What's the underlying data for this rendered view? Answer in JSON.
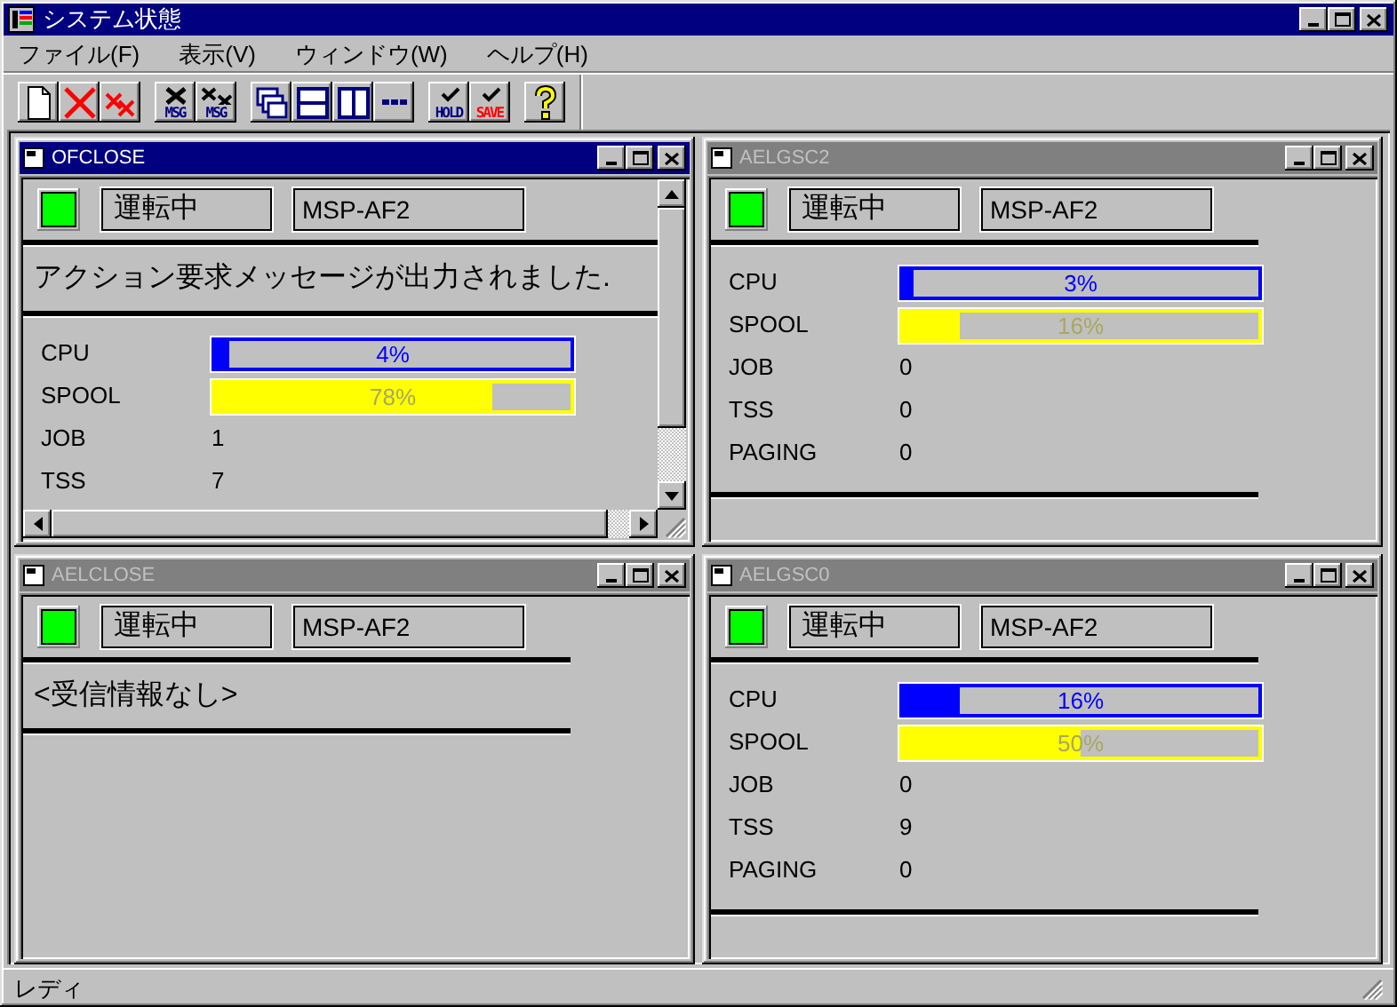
{
  "window": {
    "title": "システム状態"
  },
  "menu": [
    {
      "label": "ファイル(F)"
    },
    {
      "label": "表示(V)"
    },
    {
      "label": "ウィンドウ(W)"
    },
    {
      "label": "ヘルプ(H)"
    }
  ],
  "toolbar": [
    [
      {
        "kind": "new"
      },
      {
        "kind": "close"
      },
      {
        "kind": "close-small"
      }
    ],
    [
      {
        "kind": "x-msg",
        "label": "MSG"
      },
      {
        "kind": "xx-msg",
        "label": "MSG"
      }
    ],
    [
      {
        "kind": "cascade"
      },
      {
        "kind": "tile-h"
      },
      {
        "kind": "tile-v"
      },
      {
        "kind": "dots"
      }
    ],
    [
      {
        "kind": "hold",
        "label": "HOLD"
      },
      {
        "kind": "save",
        "label": "SAVE"
      }
    ],
    [
      {
        "kind": "help"
      }
    ]
  ],
  "children": [
    {
      "title": "OFCLOSE",
      "active": true,
      "scrollbars": true,
      "status": {
        "text": "運転中",
        "color": "#00ff00"
      },
      "system": "MSP-AF2",
      "message": "アクション要求メッセージが出力されました.",
      "metrics": [
        {
          "kind": "bar",
          "label": "CPU",
          "level": 0.04,
          "reading": "4%",
          "color": "#0000ff"
        },
        {
          "kind": "bar",
          "label": "SPOOL",
          "level": 0.78,
          "reading": "78%",
          "color": "#ffff00"
        },
        {
          "kind": "value",
          "label": "JOB",
          "value": "1"
        },
        {
          "kind": "value",
          "label": "TSS",
          "value": "7"
        }
      ]
    },
    {
      "title": "AELGSC2",
      "active": false,
      "scrollbars": false,
      "status": {
        "text": "運転中",
        "color": "#00ff00"
      },
      "system": "MSP-AF2",
      "metrics": [
        {
          "kind": "bar",
          "label": "CPU",
          "level": 0.03,
          "reading": "3%",
          "color": "#0000ff"
        },
        {
          "kind": "bar",
          "label": "SPOOL",
          "level": 0.16,
          "reading": "16%",
          "color": "#ffff00"
        },
        {
          "kind": "value",
          "label": "JOB",
          "value": "0"
        },
        {
          "kind": "value",
          "label": "TSS",
          "value": "0"
        },
        {
          "kind": "value",
          "label": "PAGING",
          "value": "0"
        }
      ]
    },
    {
      "title": "AELCLOSE",
      "active": false,
      "scrollbars": false,
      "status": {
        "text": "運転中",
        "color": "#00ff00"
      },
      "system": "MSP-AF2",
      "message": "<受信情報なし>"
    },
    {
      "title": "AELGSC0",
      "active": false,
      "scrollbars": false,
      "status": {
        "text": "運転中",
        "color": "#00ff00"
      },
      "system": "MSP-AF2",
      "metrics": [
        {
          "kind": "bar",
          "label": "CPU",
          "level": 0.16,
          "reading": "16%",
          "color": "#0000ff"
        },
        {
          "kind": "bar",
          "label": "SPOOL",
          "level": 0.5,
          "reading": "50%",
          "color": "#ffff00"
        },
        {
          "kind": "value",
          "label": "JOB",
          "value": "0"
        },
        {
          "kind": "value",
          "label": "TSS",
          "value": "9"
        },
        {
          "kind": "value",
          "label": "PAGING",
          "value": "0"
        }
      ]
    }
  ],
  "status_bar": {
    "text": "レディ"
  }
}
